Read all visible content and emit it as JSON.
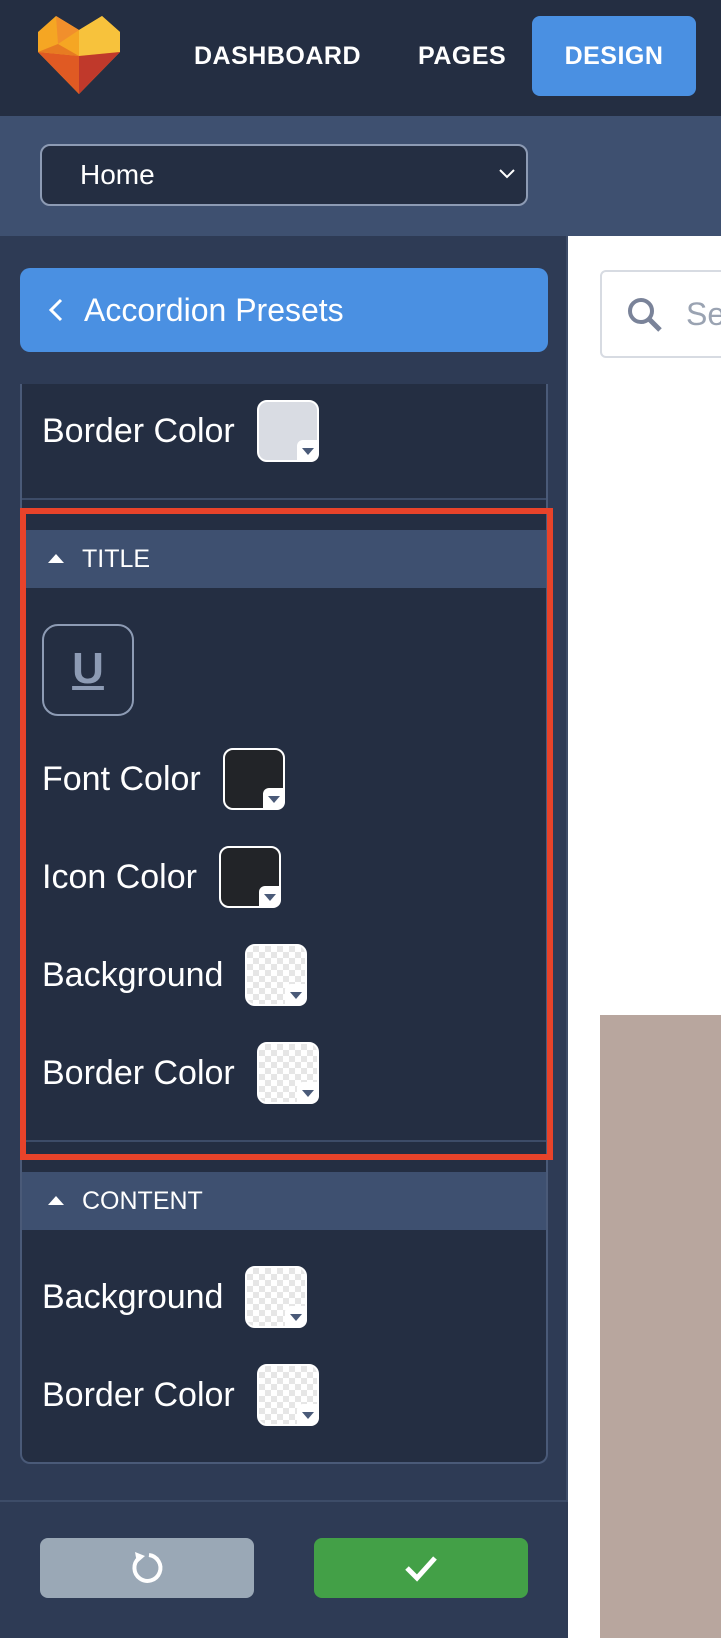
{
  "nav": {
    "items": [
      "DASHBOARD",
      "PAGES",
      "DESIGN"
    ],
    "active": "DESIGN"
  },
  "page_select": {
    "value": "Home"
  },
  "back_button": {
    "label": "Accordion Presets"
  },
  "panel": {
    "top_row": {
      "label": "Border Color",
      "swatch": "#d9dce3"
    },
    "title_section": {
      "header": "TITLE",
      "underline_label": "U",
      "rows": [
        {
          "label": "Font Color",
          "swatch": "#222428"
        },
        {
          "label": "Icon Color",
          "swatch": "#222428"
        },
        {
          "label": "Background",
          "swatch": "transparent"
        },
        {
          "label": "Border Color",
          "swatch": "transparent"
        }
      ]
    },
    "content_section": {
      "header": "CONTENT",
      "rows": [
        {
          "label": "Background",
          "swatch": "transparent"
        },
        {
          "label": "Border Color",
          "swatch": "transparent"
        }
      ]
    }
  },
  "preview": {
    "search_placeholder": "Sea"
  },
  "colors": {
    "accent": "#4a90e2",
    "confirm": "#43a047",
    "highlight": "#e8432a",
    "sidebar": "#2e3b55",
    "panel": "#242e42"
  },
  "icons": [
    "logo-icon",
    "chevron-down-icon",
    "chevron-left-icon",
    "caret-up-icon",
    "underline-icon",
    "reset-icon",
    "check-icon",
    "search-icon"
  ]
}
